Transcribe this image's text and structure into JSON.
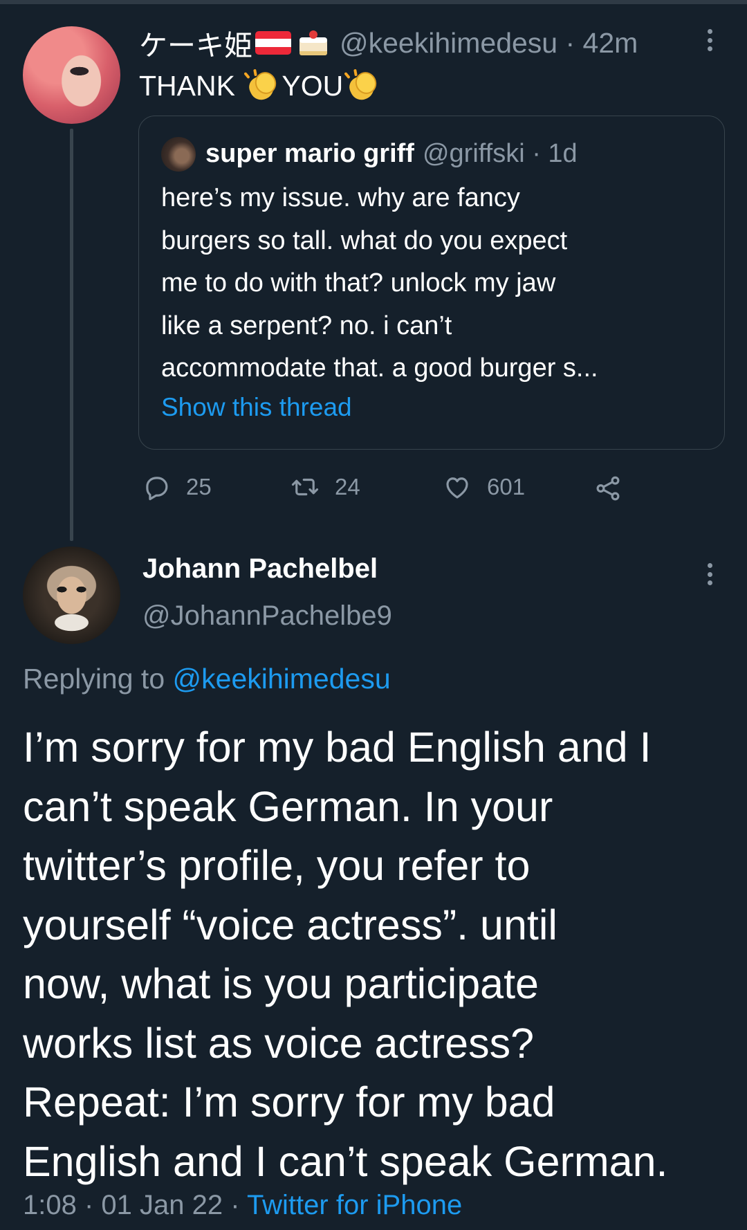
{
  "colors": {
    "background": "#15202b",
    "text": "#ffffff",
    "secondary": "#8b98a5",
    "link": "#1d9bf0",
    "border": "#38444d"
  },
  "tweet1": {
    "display_name": "ケーキ姫",
    "emoji_after_name": [
      "austria-flag",
      "shortcake"
    ],
    "handle": "@keekihimedesu",
    "separator": " · ",
    "time": "42m",
    "text_parts": [
      "THANK ",
      "YOU"
    ],
    "text_emoji": "clapping-hands",
    "quote": {
      "display_name": "super mario griff",
      "handle": "@griffski",
      "separator": " · ",
      "time": "1d",
      "lines": [
        "here’s my issue. why are fancy",
        "burgers so tall. what do you expect",
        "me to do with that? unlock my jaw",
        "like a serpent? no. i can’t",
        "accommodate that. a good burger s..."
      ],
      "show_thread": "Show this thread"
    },
    "actions": {
      "replies": "25",
      "retweets": "24",
      "likes": "601"
    }
  },
  "tweet2": {
    "display_name": "Johann Pachelbel",
    "handle": "@JohannPachelbe9",
    "replying_label": "Replying to ",
    "replying_to": "@keekihimedesu",
    "body_lines": [
      "I’m sorry for my bad English and I",
      "can’t speak German. In your",
      "twitter’s profile, you refer to",
      "yourself “voice actress”. until",
      "now, what is you participate",
      "works list as voice actress?",
      "Repeat: I’m sorry for my bad",
      "English and I can’t speak German."
    ],
    "time": "1:08",
    "separator": " · ",
    "date": "01 Jan 22",
    "source": "Twitter for iPhone"
  }
}
